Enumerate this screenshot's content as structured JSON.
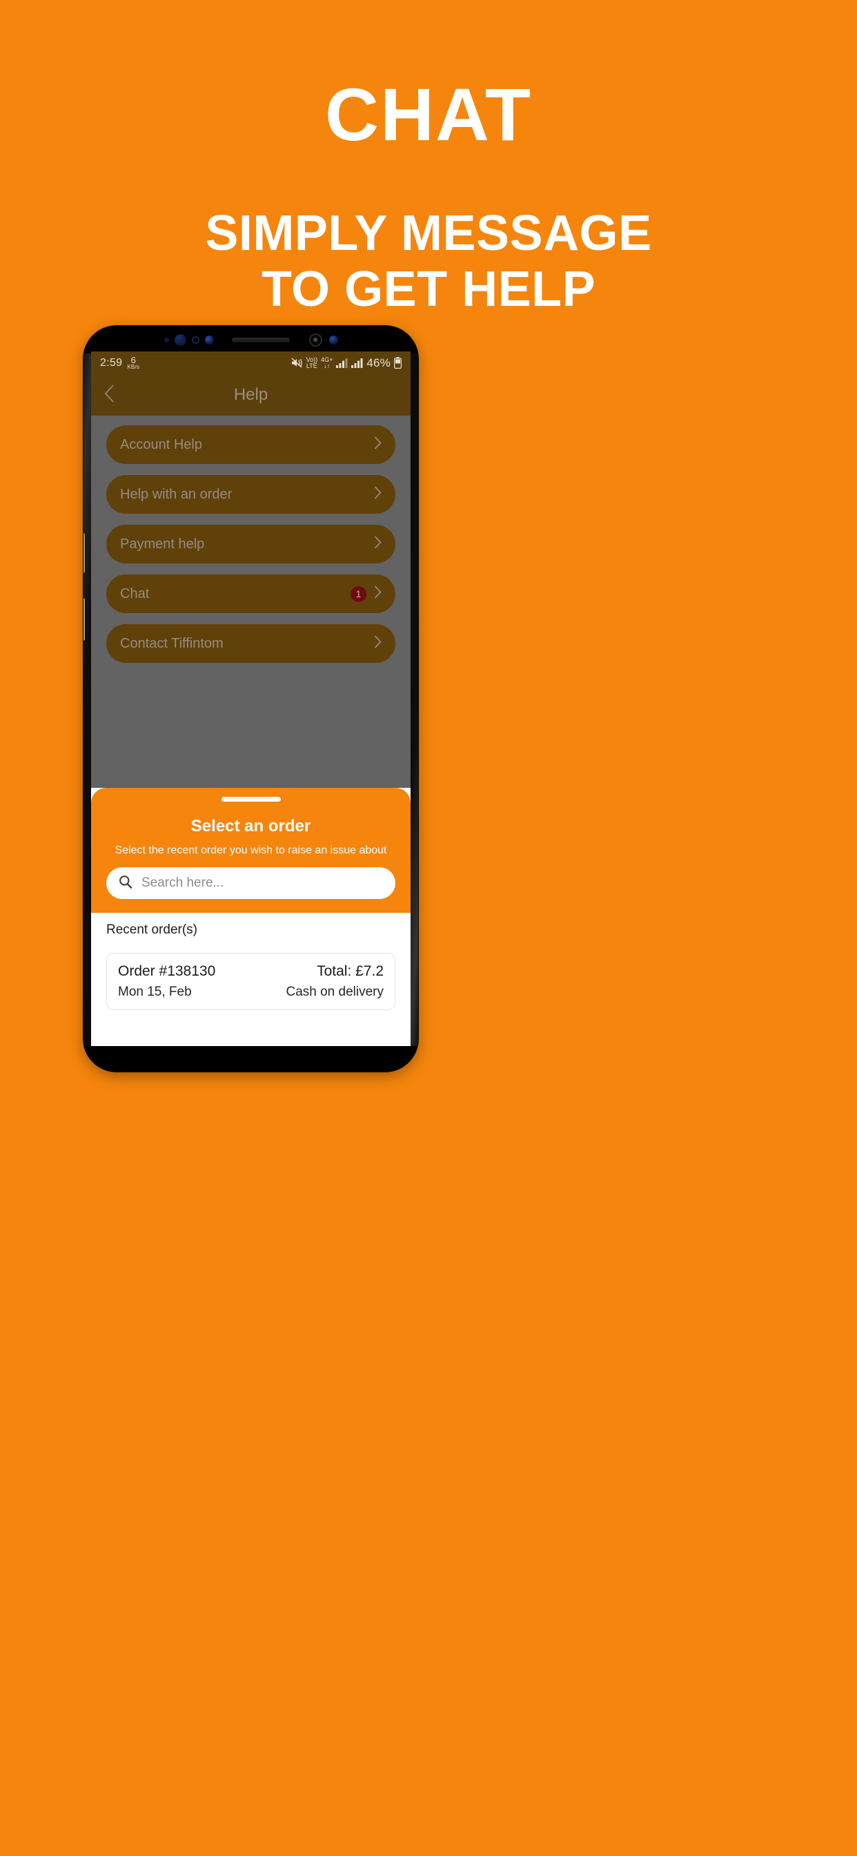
{
  "promo": {
    "title": "CHAT",
    "subtitle_line1": "SIMPLY MESSAGE",
    "subtitle_line2": "TO GET HELP",
    "background_color": "#F5850C",
    "text_color": "#FFFFFF"
  },
  "status_bar": {
    "time": "2:59",
    "network_speed_value": "6",
    "network_speed_unit": "KB/s",
    "mute_icon": "mute-icon",
    "volte_line1": "Vo))",
    "volte_line2": "LTE",
    "network_type": "4G+",
    "data_arrows": "↓↑",
    "signal_1_icon": "signal-bars-icon",
    "signal_2_icon": "signal-bars-icon",
    "battery_percent": "46%",
    "battery_icon": "battery-icon"
  },
  "nav": {
    "back_icon": "chevron-left-icon",
    "title": "Help"
  },
  "help_list": {
    "items": [
      {
        "label": "Account Help",
        "badge": "",
        "chevron": "chevron-right-icon"
      },
      {
        "label": "Help with an order",
        "badge": "",
        "chevron": "chevron-right-icon"
      },
      {
        "label": "Payment help",
        "badge": "",
        "chevron": "chevron-right-icon"
      },
      {
        "label": "Chat",
        "badge": "1",
        "chevron": "chevron-right-icon"
      },
      {
        "label": "Contact Tiffintom",
        "badge": "",
        "chevron": "chevron-right-icon"
      }
    ],
    "row_color": "#60410A",
    "badge_color": "#6F0B13"
  },
  "sheet": {
    "handle": "drag-handle",
    "title": "Select an order",
    "subtitle": "Select the recent order you wish to raise an issue about",
    "search": {
      "icon": "search-icon",
      "placeholder": "Search here...",
      "value": ""
    },
    "recent_title": "Recent order(s)",
    "orders": [
      {
        "order_id": "Order #138130",
        "date": "Mon 15, Feb",
        "total": "Total: £7.2",
        "payment": "Cash on delivery"
      }
    ]
  }
}
